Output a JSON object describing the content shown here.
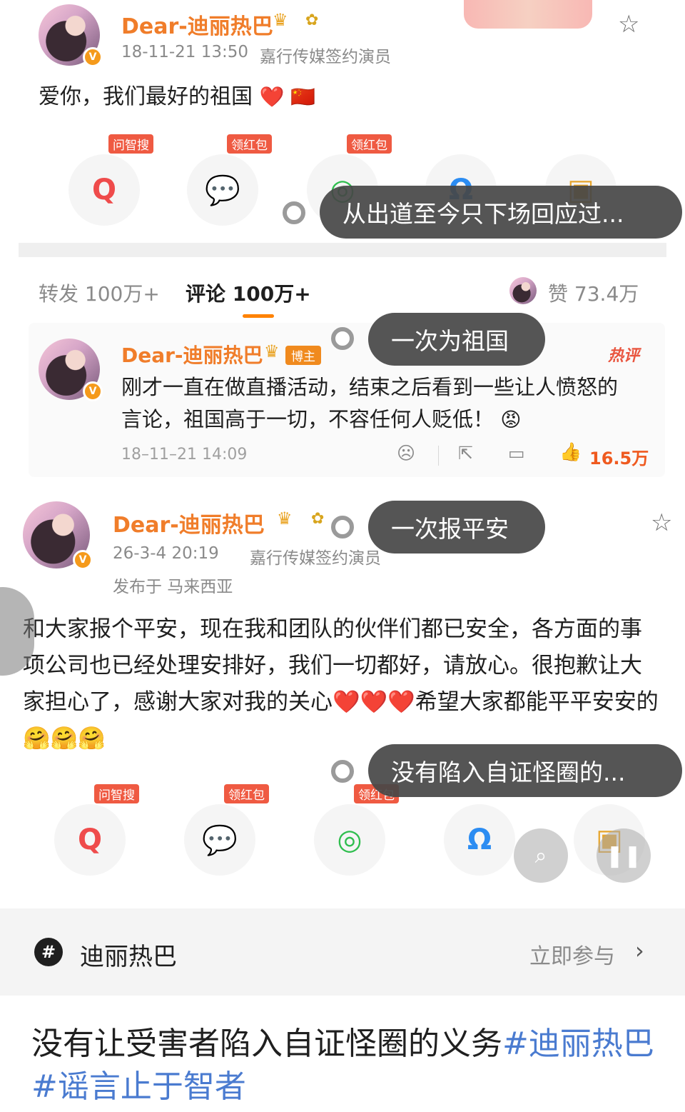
{
  "post1": {
    "username": "Dear-迪丽热巴",
    "timestamp": "18-11-21 13:50",
    "identity": "嘉行传媒签约演员",
    "text": "爱你，我们最好的祖国",
    "emoji": "❤️ 🇨🇳",
    "share": [
      {
        "tag": "问智搜",
        "icon": "search-ai-icon",
        "glyph": "Q",
        "color": "#ef4b4b"
      },
      {
        "tag": "领红包",
        "icon": "wechat-icon",
        "glyph": "💬",
        "color": "#2fbe4e"
      },
      {
        "tag": "领红包",
        "icon": "moments-icon",
        "glyph": "◎",
        "color": "#2fbe4e"
      },
      {
        "tag": "",
        "icon": "qq-icon",
        "glyph": "Ω",
        "color": "#2b8cf2"
      },
      {
        "tag": "",
        "icon": "image-icon",
        "glyph": "▣",
        "color": "#e7a52c"
      }
    ]
  },
  "bubbles": [
    {
      "text": "从出道至今只下场回应过..."
    },
    {
      "text": "一次为祖国"
    },
    {
      "text": "一次报平安"
    },
    {
      "text": "没有陷入自证怪圈的..."
    }
  ],
  "tabs": {
    "repost": "转发 100万+",
    "comment": "评论 100万+",
    "likes_label": "赞",
    "likes_count": "73.4万"
  },
  "hot_comment": {
    "username": "Dear-迪丽热巴",
    "badge": "博主",
    "hot_label": "热评",
    "text": "刚才一直在做直播活动，结束之后看到一些让人愤怒的言论，祖国高于一切，不容任何人贬低！",
    "emoji": "😡",
    "timestamp": "18–11–21 14:09",
    "like_count": "16.5万"
  },
  "post2": {
    "username": "Dear-迪丽热巴",
    "timestamp": "26-3-4 20:19",
    "identity": "嘉行传媒签约演员",
    "location": "发布于 马来西亚",
    "text": "和大家报个平安，现在我和团队的伙伴们都已安全，各方面的事项公司也已经处理安排好，我们一切都好，请放心。很抱歉让大家担心了，感谢大家对我的关心❤️❤️❤️希望大家都能平平安安的🤗🤗🤗",
    "share": [
      {
        "tag": "问智搜",
        "icon": "search-ai-icon",
        "glyph": "Q",
        "color": "#ef4b4b"
      },
      {
        "tag": "领红包",
        "icon": "wechat-icon",
        "glyph": "💬",
        "color": "#2fbe4e"
      },
      {
        "tag": "领红包",
        "icon": "moments-icon",
        "glyph": "◎",
        "color": "#2fbe4e"
      },
      {
        "tag": "",
        "icon": "qq-icon",
        "glyph": "Ω",
        "color": "#2b8cf2"
      },
      {
        "tag": "",
        "icon": "image-icon",
        "glyph": "▣",
        "color": "#e7a52c"
      }
    ]
  },
  "topic": {
    "name": "迪丽热巴",
    "action": "立即参与"
  },
  "headline": {
    "text": "没有让受害者陷入自证怪圈的义务",
    "tag1": "#迪丽热巴",
    "tag2": "#谣言止于智者"
  },
  "colors": {
    "accent": "#ff8200",
    "username": "#f07d2a",
    "hashtag": "#4a7bd0",
    "bubble": "#464646"
  }
}
